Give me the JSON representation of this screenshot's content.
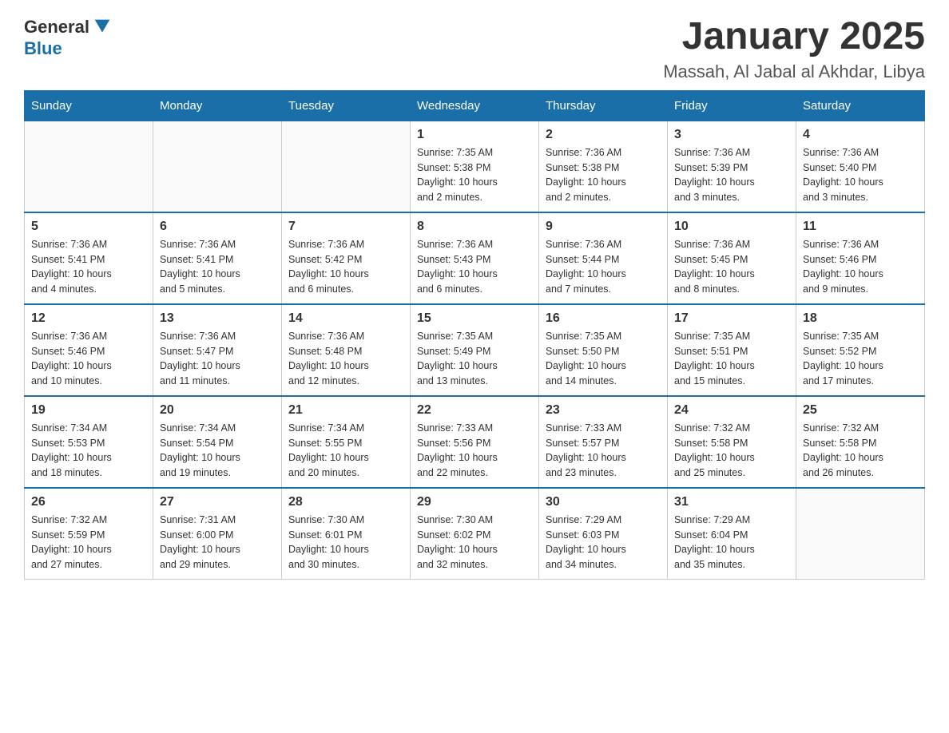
{
  "header": {
    "logo": {
      "general": "General",
      "blue": "Blue"
    },
    "month": "January 2025",
    "location": "Massah, Al Jabal al Akhdar, Libya"
  },
  "weekdays": [
    "Sunday",
    "Monday",
    "Tuesday",
    "Wednesday",
    "Thursday",
    "Friday",
    "Saturday"
  ],
  "weeks": [
    [
      {
        "day": "",
        "info": ""
      },
      {
        "day": "",
        "info": ""
      },
      {
        "day": "",
        "info": ""
      },
      {
        "day": "1",
        "info": "Sunrise: 7:35 AM\nSunset: 5:38 PM\nDaylight: 10 hours\nand 2 minutes."
      },
      {
        "day": "2",
        "info": "Sunrise: 7:36 AM\nSunset: 5:38 PM\nDaylight: 10 hours\nand 2 minutes."
      },
      {
        "day": "3",
        "info": "Sunrise: 7:36 AM\nSunset: 5:39 PM\nDaylight: 10 hours\nand 3 minutes."
      },
      {
        "day": "4",
        "info": "Sunrise: 7:36 AM\nSunset: 5:40 PM\nDaylight: 10 hours\nand 3 minutes."
      }
    ],
    [
      {
        "day": "5",
        "info": "Sunrise: 7:36 AM\nSunset: 5:41 PM\nDaylight: 10 hours\nand 4 minutes."
      },
      {
        "day": "6",
        "info": "Sunrise: 7:36 AM\nSunset: 5:41 PM\nDaylight: 10 hours\nand 5 minutes."
      },
      {
        "day": "7",
        "info": "Sunrise: 7:36 AM\nSunset: 5:42 PM\nDaylight: 10 hours\nand 6 minutes."
      },
      {
        "day": "8",
        "info": "Sunrise: 7:36 AM\nSunset: 5:43 PM\nDaylight: 10 hours\nand 6 minutes."
      },
      {
        "day": "9",
        "info": "Sunrise: 7:36 AM\nSunset: 5:44 PM\nDaylight: 10 hours\nand 7 minutes."
      },
      {
        "day": "10",
        "info": "Sunrise: 7:36 AM\nSunset: 5:45 PM\nDaylight: 10 hours\nand 8 minutes."
      },
      {
        "day": "11",
        "info": "Sunrise: 7:36 AM\nSunset: 5:46 PM\nDaylight: 10 hours\nand 9 minutes."
      }
    ],
    [
      {
        "day": "12",
        "info": "Sunrise: 7:36 AM\nSunset: 5:46 PM\nDaylight: 10 hours\nand 10 minutes."
      },
      {
        "day": "13",
        "info": "Sunrise: 7:36 AM\nSunset: 5:47 PM\nDaylight: 10 hours\nand 11 minutes."
      },
      {
        "day": "14",
        "info": "Sunrise: 7:36 AM\nSunset: 5:48 PM\nDaylight: 10 hours\nand 12 minutes."
      },
      {
        "day": "15",
        "info": "Sunrise: 7:35 AM\nSunset: 5:49 PM\nDaylight: 10 hours\nand 13 minutes."
      },
      {
        "day": "16",
        "info": "Sunrise: 7:35 AM\nSunset: 5:50 PM\nDaylight: 10 hours\nand 14 minutes."
      },
      {
        "day": "17",
        "info": "Sunrise: 7:35 AM\nSunset: 5:51 PM\nDaylight: 10 hours\nand 15 minutes."
      },
      {
        "day": "18",
        "info": "Sunrise: 7:35 AM\nSunset: 5:52 PM\nDaylight: 10 hours\nand 17 minutes."
      }
    ],
    [
      {
        "day": "19",
        "info": "Sunrise: 7:34 AM\nSunset: 5:53 PM\nDaylight: 10 hours\nand 18 minutes."
      },
      {
        "day": "20",
        "info": "Sunrise: 7:34 AM\nSunset: 5:54 PM\nDaylight: 10 hours\nand 19 minutes."
      },
      {
        "day": "21",
        "info": "Sunrise: 7:34 AM\nSunset: 5:55 PM\nDaylight: 10 hours\nand 20 minutes."
      },
      {
        "day": "22",
        "info": "Sunrise: 7:33 AM\nSunset: 5:56 PM\nDaylight: 10 hours\nand 22 minutes."
      },
      {
        "day": "23",
        "info": "Sunrise: 7:33 AM\nSunset: 5:57 PM\nDaylight: 10 hours\nand 23 minutes."
      },
      {
        "day": "24",
        "info": "Sunrise: 7:32 AM\nSunset: 5:58 PM\nDaylight: 10 hours\nand 25 minutes."
      },
      {
        "day": "25",
        "info": "Sunrise: 7:32 AM\nSunset: 5:58 PM\nDaylight: 10 hours\nand 26 minutes."
      }
    ],
    [
      {
        "day": "26",
        "info": "Sunrise: 7:32 AM\nSunset: 5:59 PM\nDaylight: 10 hours\nand 27 minutes."
      },
      {
        "day": "27",
        "info": "Sunrise: 7:31 AM\nSunset: 6:00 PM\nDaylight: 10 hours\nand 29 minutes."
      },
      {
        "day": "28",
        "info": "Sunrise: 7:30 AM\nSunset: 6:01 PM\nDaylight: 10 hours\nand 30 minutes."
      },
      {
        "day": "29",
        "info": "Sunrise: 7:30 AM\nSunset: 6:02 PM\nDaylight: 10 hours\nand 32 minutes."
      },
      {
        "day": "30",
        "info": "Sunrise: 7:29 AM\nSunset: 6:03 PM\nDaylight: 10 hours\nand 34 minutes."
      },
      {
        "day": "31",
        "info": "Sunrise: 7:29 AM\nSunset: 6:04 PM\nDaylight: 10 hours\nand 35 minutes."
      },
      {
        "day": "",
        "info": ""
      }
    ]
  ]
}
